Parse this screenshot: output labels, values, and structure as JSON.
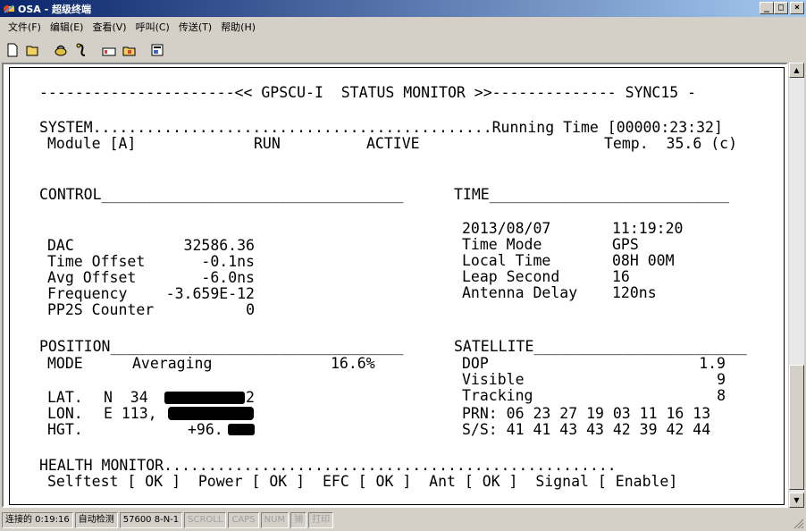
{
  "window": {
    "title": "OSA - 超级终端"
  },
  "menu": [
    "文件(F)",
    "编辑(E)",
    "查看(V)",
    "呼叫(C)",
    "传送(T)",
    "帮助(H)"
  ],
  "toolbar": [
    "new-icon",
    "open-icon",
    "connect-icon",
    "disconnect-icon",
    "send-icon",
    "receive-icon",
    "properties-icon"
  ],
  "terminal": {
    "header": "----------------------<< GPSCU-I  STATUS MONITOR >>-------------- SYNC15 -",
    "system": {
      "label": "SYSTEM.............................................Running Time [00000:23:32]",
      "module": "Module [A]",
      "run": "RUN",
      "active": "ACTIVE",
      "temp": "Temp.  35.6 (c)"
    },
    "control": {
      "heading": "CONTROL__________________________________",
      "rows": [
        {
          "label": "DAC",
          "value": "32586.36"
        },
        {
          "label": "Time Offset",
          "value": "-0.1ns"
        },
        {
          "label": "Avg Offset",
          "value": "-6.0ns"
        },
        {
          "label": "Frequency",
          "value": "-3.659E-12"
        },
        {
          "label": "PP2S Counter",
          "value": "0"
        }
      ]
    },
    "time": {
      "heading": "TIME___________________________",
      "rows": [
        {
          "label": "2013/08/07",
          "value": "11:19:20"
        },
        {
          "label": "Time Mode",
          "value": "GPS"
        },
        {
          "label": "Local Time",
          "value": "08H 00M"
        },
        {
          "label": "Leap Second",
          "value": "16"
        },
        {
          "label": "Antenna Delay",
          "value": "120ns"
        }
      ]
    },
    "position": {
      "heading": "POSITION_________________________________",
      "mode_label": "MODE",
      "mode_value": "Averaging",
      "percent": "16.6%",
      "lat_label": "LAT.",
      "lat_prefix": "N  34",
      "lat_suffix": "2",
      "lon_label": "LON.",
      "lon_prefix": "E 113,",
      "hgt_label": "HGT.",
      "hgt_prefix": "+96."
    },
    "satellite": {
      "heading": "SATELLITE________________________",
      "rows": [
        {
          "label": "DOP",
          "value": "1.9"
        },
        {
          "label": "Visible",
          "value": "9"
        },
        {
          "label": "Tracking",
          "value": "8"
        }
      ],
      "prn": "PRN: 06 23 27 19 03 11 16 13",
      "ss": "S/S: 41 41 43 43 42 39 42 44"
    },
    "health": {
      "label": "HEALTH MONITOR...................................................",
      "line": "Selftest [ OK ]  Power [ OK ]  EFC [ OK ]  Ant [ OK ]  Signal [ Enable]"
    }
  },
  "statusbar": {
    "connected": "连接的 0:19:16",
    "detect": "自动检测",
    "params": "57600 8-N-1",
    "scroll": "SCROLL",
    "caps": "CAPS",
    "num": "NUM",
    "capture": "捕",
    "print": "打印"
  }
}
